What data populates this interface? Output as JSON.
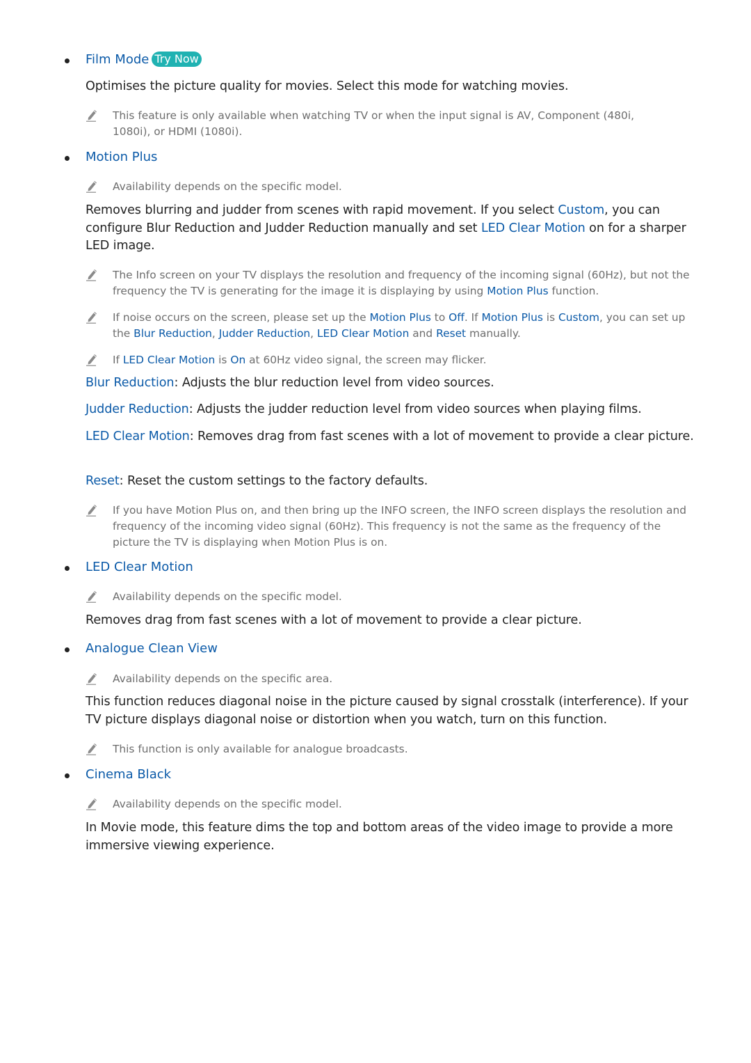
{
  "film_mode": {
    "title": "Film Mode",
    "try_now_label": "Try Now",
    "description": "Optimises the picture quality for movies. Select this mode for watching movies.",
    "note_line1": "This feature is only available when watching TV or when the input signal is AV, Component (480i,",
    "note_line2": "1080i), or HDMI (1080i)."
  },
  "motion_plus": {
    "title": "Motion Plus",
    "availability_note": "Availability depends on the specific model.",
    "desc_1": "Removes blurring and judder from scenes with rapid movement. If you select ",
    "desc_custom": "Custom",
    "desc_2": ", you can configure Blur Reduction and Judder Reduction manually and set ",
    "desc_led": "LED Clear Motion",
    "desc_3": " on for a sharper LED image.",
    "note_info_1": "The Info screen on your TV displays the resolution and frequency of the incoming signal (60Hz), but not the frequency the TV is generating for the image it is displaying by using ",
    "note_info_hl": "Motion Plus",
    "note_info_2": " function.",
    "note_noise": {
      "t1": "If noise occurs on the screen, please set up the ",
      "h1": "Motion Plus",
      "t2": " to ",
      "h2": "Off",
      "t3": ". If ",
      "h3": "Motion Plus",
      "t4": " is ",
      "h4": "Custom",
      "t5": ", you can set up the ",
      "h5": "Blur Reduction",
      "t6": ", ",
      "h6": "Judder Reduction",
      "t7": ", ",
      "h7": "LED Clear Motion",
      "t8": " and ",
      "h8": "Reset",
      "t9": " manually."
    },
    "note_flicker": {
      "t1": "If ",
      "h1": "LED Clear Motion",
      "t2": " is ",
      "h2": "On",
      "t3": " at 60Hz video signal, the screen may flicker."
    },
    "options": [
      {
        "name": "Blur Reduction",
        "text": ": Adjusts the blur reduction level from video sources."
      },
      {
        "name": "Judder Reduction",
        "text": ": Adjusts the judder reduction level from video sources when playing films."
      },
      {
        "name": "LED Clear Motion",
        "text": ": Removes drag from fast scenes with a lot of movement to provide a clear picture."
      },
      {
        "name": "Reset",
        "text": ": Reset the custom settings to the factory defaults."
      }
    ],
    "note_info_screen": "If you have Motion Plus on, and then bring up the INFO screen, the INFO screen displays the resolution and frequency of the incoming video signal (60Hz). This frequency is not the same as the frequency of the picture the TV is displaying when Motion Plus is on."
  },
  "led_clear_motion": {
    "title": "LED Clear Motion",
    "availability_note": "Availability depends on the specific model.",
    "description": "Removes drag from fast scenes with a lot of movement to provide a clear picture."
  },
  "analogue_clean_view": {
    "title": "Analogue Clean View",
    "availability_note": "Availability depends on the specific area.",
    "description": "This function reduces diagonal noise in the picture caused by signal crosstalk (interference). If your TV picture displays diagonal noise or distortion when you watch, turn on this function.",
    "note": "This function is only available for analogue broadcasts."
  },
  "cinema_black": {
    "title": "Cinema Black",
    "availability_note": "Availability depends on the specific model.",
    "description": "In Movie mode, this feature dims the top and bottom areas of the video image to provide a more immersive viewing experience."
  },
  "colors": {
    "link_blue": "#0b5aa8",
    "try_now_teal": "#20b2b2",
    "body_text": "#222222",
    "note_text": "#6d6d6d"
  }
}
